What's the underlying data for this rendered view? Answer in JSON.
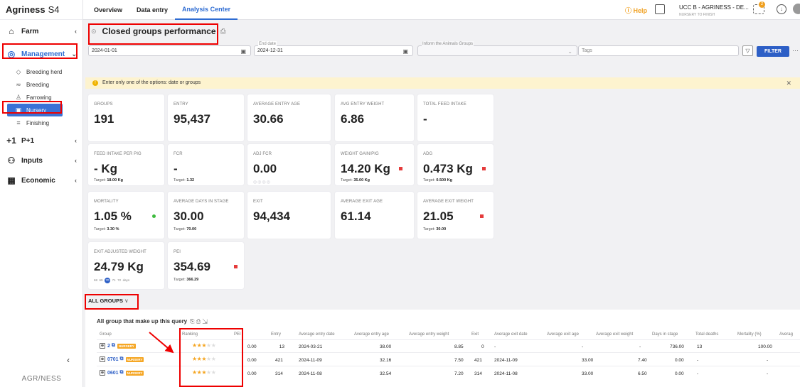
{
  "app": {
    "name": "Agriness",
    "version": "S4",
    "footer": "AGR/NESS"
  },
  "sidebar": {
    "items": [
      {
        "label": "Farm",
        "icon": "home-icon"
      },
      {
        "label": "Management",
        "icon": "management-icon"
      },
      {
        "label": "P+1",
        "icon": "p1-icon"
      },
      {
        "label": "Inputs",
        "icon": "inputs-icon"
      },
      {
        "label": "Economic",
        "icon": "economic-icon"
      }
    ],
    "sub_items": [
      {
        "label": "Breeding herd"
      },
      {
        "label": "Breeding"
      },
      {
        "label": "Farrowing"
      },
      {
        "label": "Nursery"
      },
      {
        "label": "Finishing"
      }
    ],
    "collapse": "‹"
  },
  "topbar": {
    "tabs": [
      {
        "label": "Overview"
      },
      {
        "label": "Data entry"
      },
      {
        "label": "Analysis Center"
      }
    ],
    "help": "Help",
    "farm": "UCC B - AGRINESS - DE...",
    "farm_sub": "NURSERY TO FINISH",
    "badge": "2"
  },
  "page": {
    "title": "Closed groups performance",
    "start_date": "2024-01-01",
    "end_date_label": "End date",
    "end_date": "2024-12-31",
    "animals_groups_label": "Inform the Animals Groups",
    "tags_placeholder": "Tags",
    "filter": "FILTER",
    "more": "···"
  },
  "info": {
    "text": "Enter only one of the options: date or groups",
    "close": "✕",
    "warn": "!"
  },
  "cards": [
    {
      "label": "GROUPS",
      "value": "191"
    },
    {
      "label": "ENTRY",
      "value": "95,437"
    },
    {
      "label": "AVERAGE ENTRY AGE",
      "value": "30.66"
    },
    {
      "label": "AVG ENTRY WEIGHT",
      "value": "6.86"
    },
    {
      "label": "TOTAL FEED INTAKE",
      "value": "-"
    },
    {
      "label": "FEED INTAKE PER PIG",
      "value": "- Kg",
      "target_label": "Target:",
      "target": "18.00 Kg"
    },
    {
      "label": "FCR",
      "value": "-",
      "target_label": "Target:",
      "target": "1.32"
    },
    {
      "label": "ADJ FCR",
      "value": "0.00"
    },
    {
      "label": "WEIGHT GAIN/PIG",
      "value": "14.20 Kg",
      "target_label": "Target:",
      "target": "35.00 Kg",
      "status": "#e53b3b"
    },
    {
      "label": "ADG",
      "value": "0.473 Kg",
      "target_label": "Target:",
      "target": "0.500 Kg",
      "status": "#e53b3b"
    },
    {
      "label": "MORTALITY",
      "value": "1.05 %",
      "target_label": "Target:",
      "target": "3.30 %",
      "status": "#3dbb3d"
    },
    {
      "label": "AVERAGE DAYS IN STAGE",
      "value": "30.00",
      "target_label": "Target:",
      "target": "70.00"
    },
    {
      "label": "EXIT",
      "value": "94,434"
    },
    {
      "label": "AVERAGE EXIT AGE",
      "value": "61.14"
    },
    {
      "label": "AVERAGE EXIT WEIGHT",
      "value": "21.05",
      "target_label": "Target:",
      "target": "30.00",
      "status": "#e53b3b"
    },
    {
      "label": "EXIT ADJUSTED WEIGHT",
      "value": "24.79 Kg"
    },
    {
      "label": "PEI",
      "value": "354.69",
      "target_label": "Target:",
      "target": "366.29",
      "status": "#e53b3b"
    }
  ],
  "adj_weight_days": {
    "d1": "68",
    "d2": "69",
    "sel": "70",
    "d4": "71",
    "d5": "72",
    "unit": "days"
  },
  "all_groups": {
    "label": "ALL GROUPS",
    "chevron": "∨"
  },
  "table": {
    "title": "All group that make up this query",
    "columns": [
      "Group",
      "Ranking",
      "PEI",
      "Entry",
      "Average entry date",
      "Average entry age",
      "Average entry weight",
      "Exit",
      "Average exit date",
      "Average exit age",
      "Average exit weight",
      "Days in stage",
      "Total deaths",
      "Mortality (%)",
      "Averag"
    ],
    "tag": "NURSERY",
    "rows": [
      {
        "group": "2",
        "stars": 3,
        "pei": "0.00",
        "entry": "13",
        "entry_date": "2024-03-21",
        "entry_age": "38.00",
        "entry_weight": "8.85",
        "exit": "0",
        "exit_date": "-",
        "exit_age": "-",
        "exit_weight": "-",
        "days": "736.00",
        "deaths": "13",
        "mortality": "100.00"
      },
      {
        "group": "0701",
        "stars": 3,
        "pei": "0.00",
        "entry": "421",
        "entry_date": "2024-11-09",
        "entry_age": "32.16",
        "entry_weight": "7.50",
        "exit": "421",
        "exit_date": "2024-11-09",
        "exit_age": "33.00",
        "exit_weight": "7.40",
        "days": "0.00",
        "deaths": "-",
        "mortality": "-"
      },
      {
        "group": "0601",
        "stars": 3,
        "pei": "0.00",
        "entry": "314",
        "entry_date": "2024-11-08",
        "entry_age": "32.54",
        "entry_weight": "7.20",
        "exit": "314",
        "exit_date": "2024-11-08",
        "exit_age": "33.00",
        "exit_weight": "6.50",
        "days": "0.00",
        "deaths": "-",
        "mortality": "-"
      }
    ]
  }
}
